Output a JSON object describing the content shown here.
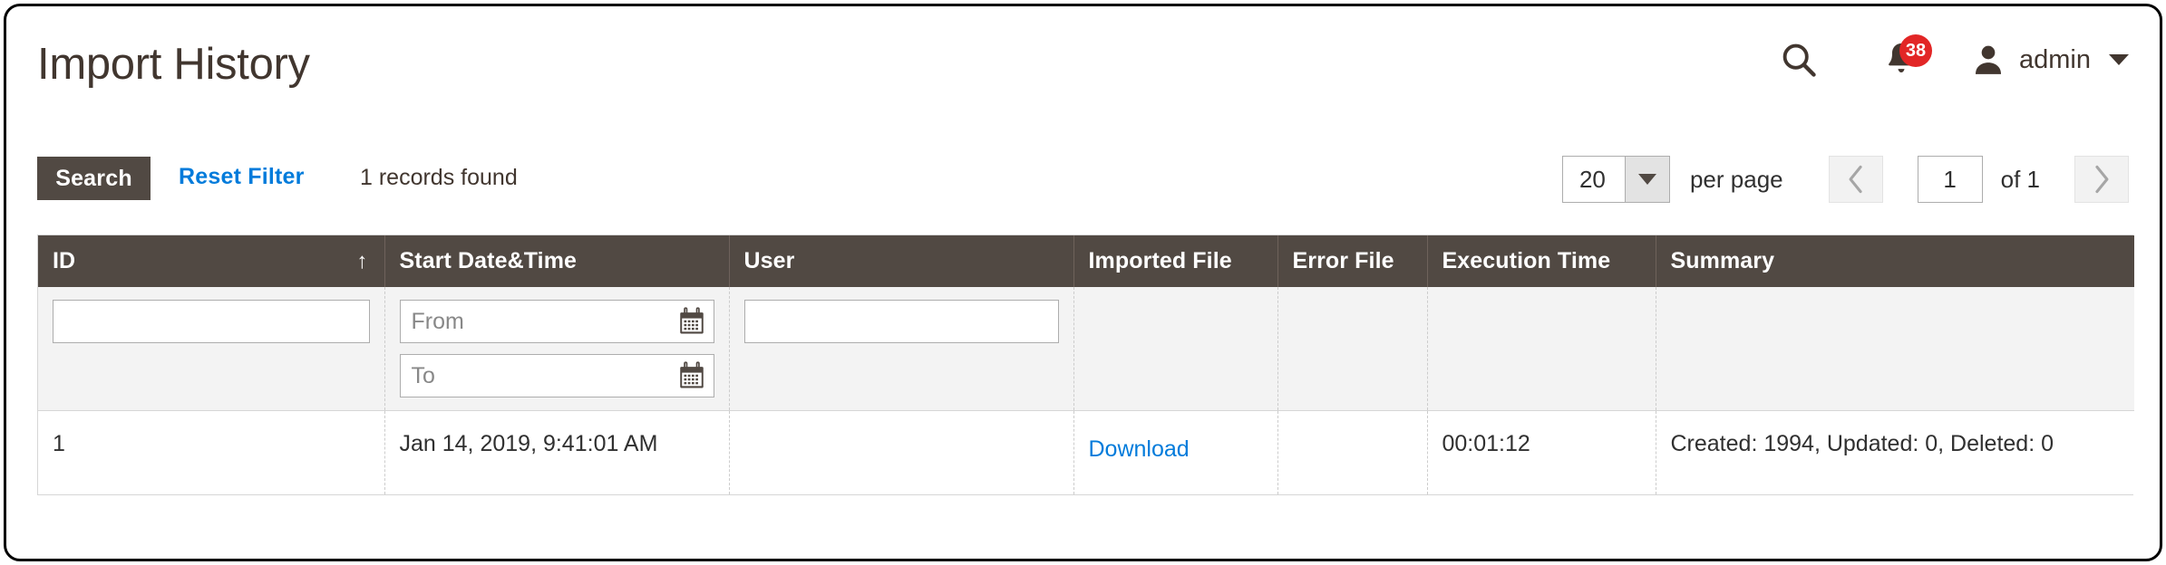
{
  "header": {
    "title": "Import History",
    "search_icon": "search-icon",
    "notifications_icon": "bell-icon",
    "notifications_count": "38",
    "user_icon": "user-avatar-icon",
    "user_name": "admin",
    "caret_icon": "chevron-down-icon"
  },
  "toolbar": {
    "search_label": "Search",
    "reset_filter_label": "Reset Filter",
    "records_found": "1 records found"
  },
  "pager": {
    "limit_value": "20",
    "limit_arrow_icon": "chevron-down-icon",
    "per_page_label": "per page",
    "prev_icon": "chevron-left-icon",
    "next_icon": "chevron-right-icon",
    "current_page": "1",
    "of_label": "of 1"
  },
  "grid": {
    "columns": [
      {
        "label": "ID",
        "sort_indicator": "↑"
      },
      {
        "label": "Start Date&Time",
        "sort_indicator": ""
      },
      {
        "label": "User",
        "sort_indicator": ""
      },
      {
        "label": "Imported File",
        "sort_indicator": ""
      },
      {
        "label": "Error File",
        "sort_indicator": ""
      },
      {
        "label": "Execution Time",
        "sort_indicator": ""
      },
      {
        "label": "Summary",
        "sort_indicator": ""
      }
    ],
    "filters": {
      "id_value": "",
      "id_placeholder": "",
      "date_from_value": "",
      "date_from_placeholder": "From",
      "date_to_value": "",
      "date_to_placeholder": "To",
      "user_value": "",
      "user_placeholder": ""
    },
    "rows": [
      {
        "id": "1",
        "start_date_time": "Jan 14, 2019, 9:41:01 AM",
        "user": "",
        "imported_file": "Download",
        "error_file": "",
        "execution_time": "00:01:12",
        "summary": "Created: 1994, Updated: 0, Deleted: 0"
      }
    ]
  },
  "colors": {
    "header_bar": "#514943",
    "link_blue": "#007bdb",
    "badge_red": "#e22626",
    "filter_row_bg": "#f3f3f3",
    "text_dark": "#303030"
  }
}
